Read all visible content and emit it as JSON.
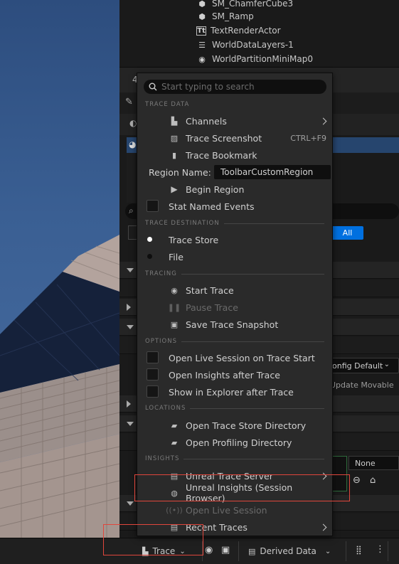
{
  "outliner": {
    "items": [
      {
        "label": "SM_ChamferCube3",
        "icon": "static-mesh-icon"
      },
      {
        "label": "SM_Ramp",
        "icon": "static-mesh-icon"
      },
      {
        "label": "TextRenderActor",
        "icon": "text-render-icon"
      },
      {
        "label": "WorldDataLayers-1",
        "icon": "layers-icon"
      },
      {
        "label": "WorldPartitionMiniMap0",
        "icon": "minimap-icon"
      }
    ],
    "count_prefix": "4"
  },
  "details": {
    "filter_all_label": "All",
    "config_dropdown": "onfig Default",
    "update_dropdown": "Update Movable",
    "none_dropdown": "None"
  },
  "menu": {
    "search_placeholder": "Start typing to search",
    "sections": {
      "trace_data": "TRACE DATA",
      "trace_destination": "TRACE DESTINATION",
      "tracing": "TRACING",
      "options": "OPTIONS",
      "locations": "LOCATIONS",
      "insights": "INSIGHTS"
    },
    "items": {
      "channels": "Channels",
      "trace_screenshot": "Trace Screenshot",
      "trace_screenshot_shortcut": "CTRL+F9",
      "trace_bookmark": "Trace Bookmark",
      "region_name_label": "Region Name:",
      "region_name_value": "ToolbarCustomRegion",
      "begin_region": "Begin Region",
      "stat_named_events": "Stat Named Events",
      "trace_store": "Trace Store",
      "file": "File",
      "start_trace": "Start Trace",
      "pause_trace": "Pause Trace",
      "save_trace_snapshot": "Save Trace Snapshot",
      "open_live_session_on_start": "Open Live Session on Trace Start",
      "open_insights_after_trace": "Open Insights after Trace",
      "show_in_explorer_after_trace": "Show in Explorer after Trace",
      "open_trace_store_directory": "Open Trace Store Directory",
      "open_profiling_directory": "Open Profiling Directory",
      "unreal_trace_server": "Unreal Trace Server",
      "unreal_insights_session_browser": "Unreal Insights (Session Browser)",
      "open_live_session": "Open Live Session",
      "recent_traces": "Recent Traces"
    },
    "destination_selected": "Trace Store"
  },
  "bottom_bar": {
    "trace_label": "Trace",
    "derived_data_label": "Derived Data"
  },
  "colors": {
    "accent": "#0070e0",
    "highlight_box": "#e0463c",
    "menu_bg": "#2a2a2a"
  }
}
